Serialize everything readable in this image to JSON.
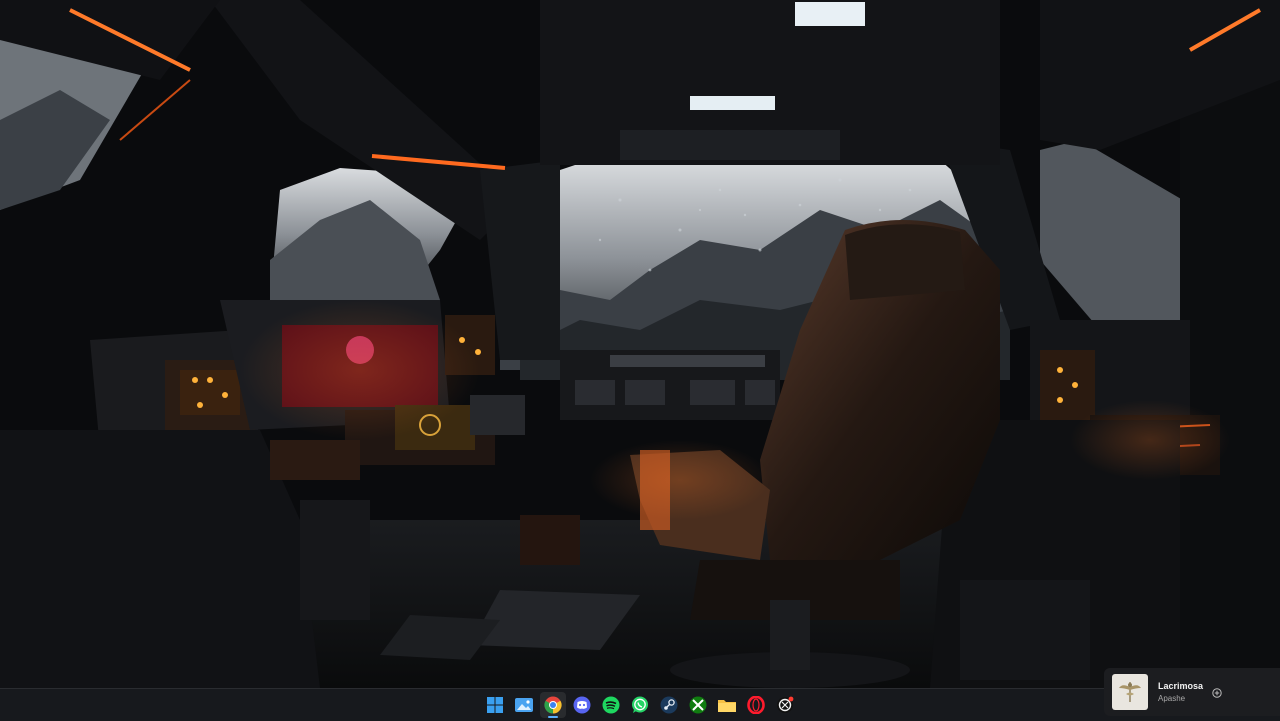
{
  "desktop": {
    "wallpaper_description_icon": "cockpit-wallpaper"
  },
  "taskbar": {
    "apps": [
      {
        "name": "start",
        "icon": "windows-logo-icon",
        "active": false
      },
      {
        "name": "photos",
        "icon": "photos-icon",
        "active": false
      },
      {
        "name": "chrome",
        "icon": "chrome-icon",
        "active": true
      },
      {
        "name": "discord",
        "icon": "discord-icon",
        "active": false
      },
      {
        "name": "spotify",
        "icon": "spotify-icon",
        "active": false
      },
      {
        "name": "whatsapp",
        "icon": "whatsapp-icon",
        "active": false
      },
      {
        "name": "steam",
        "icon": "steam-icon",
        "active": false
      },
      {
        "name": "xbox",
        "icon": "xbox-icon",
        "active": false
      },
      {
        "name": "file-explorer",
        "icon": "folder-icon",
        "active": false
      },
      {
        "name": "opera",
        "icon": "opera-icon",
        "active": false
      },
      {
        "name": "chatgpt",
        "icon": "openai-icon",
        "active": false
      }
    ]
  },
  "media": {
    "title": "Lacrimosa",
    "artist": "Apashe"
  },
  "colors": {
    "accent_orange": "#ff6a1f",
    "taskbar_bg": "#181a1e",
    "chrome_blue": "#5ab0ff"
  }
}
